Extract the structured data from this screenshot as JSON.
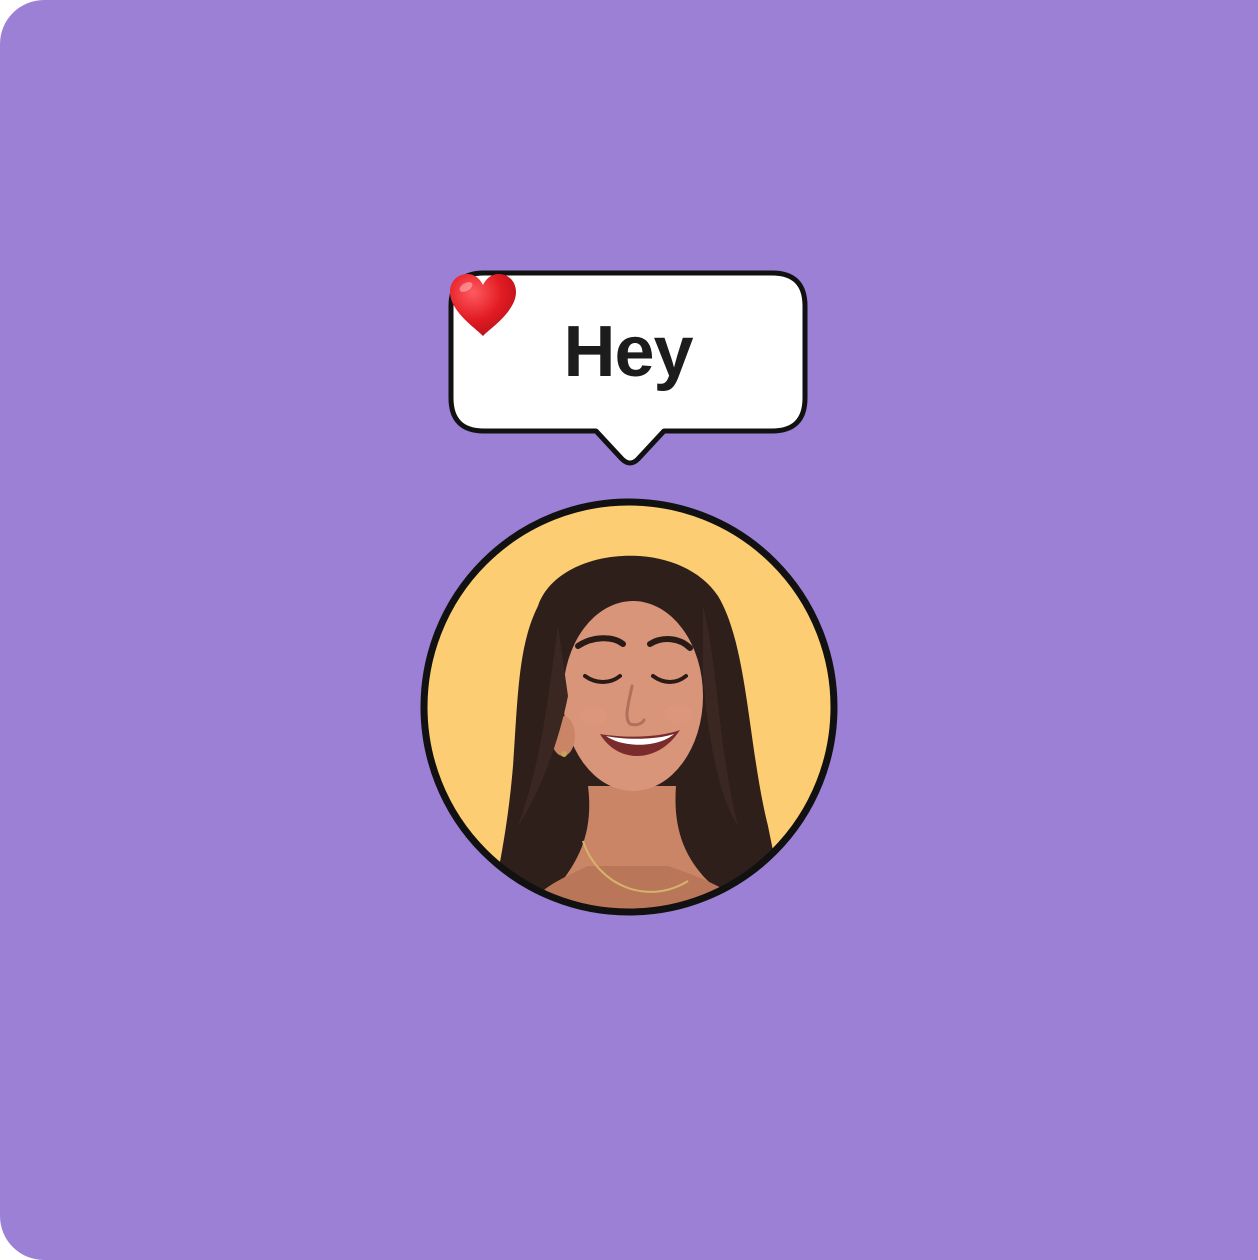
{
  "colors": {
    "background": "#9b80d5",
    "bubble_fill": "#ffffff",
    "outline": "#111111",
    "heart": "#e21b23",
    "avatar_background": "#fdcd74"
  },
  "speech_bubble": {
    "text": "Hey",
    "emoji": "heart-icon"
  },
  "avatar": {
    "description_icon": "smiling-woman-photo"
  }
}
